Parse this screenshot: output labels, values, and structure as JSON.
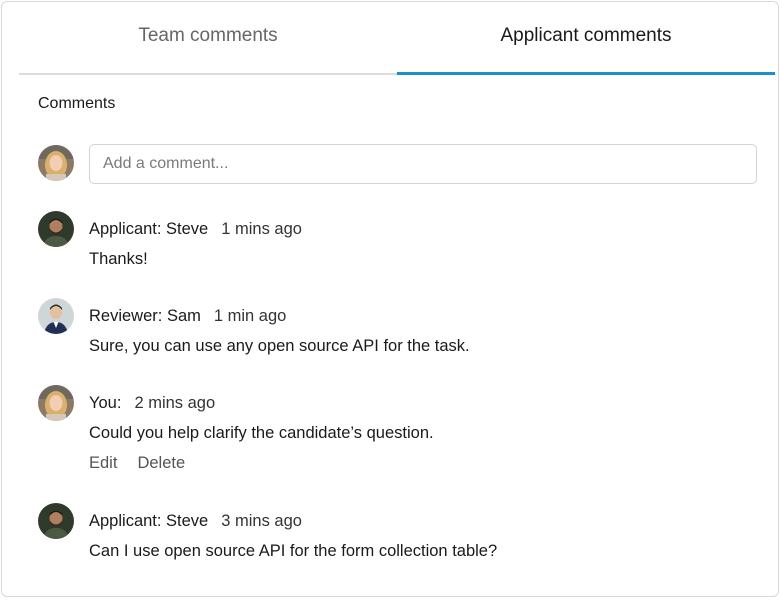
{
  "tabs": [
    {
      "label": "Team comments",
      "active": false
    },
    {
      "label": "Applicant comments",
      "active": true
    }
  ],
  "section_title": "Comments",
  "add_comment": {
    "placeholder": "Add a comment..."
  },
  "comments": [
    {
      "author": "Applicant: Steve",
      "time": "1 mins ago",
      "text": "Thanks!",
      "avatar": "steve"
    },
    {
      "author": "Reviewer: Sam",
      "time": "1 min ago",
      "text": "Sure, you can use any open source API for the task.",
      "avatar": "sam"
    },
    {
      "author": "You:",
      "time": "2 mins ago",
      "text": "Could you help clarify the candidate’s question.",
      "avatar": "you",
      "actions": {
        "edit": "Edit",
        "delete": "Delete"
      }
    },
    {
      "author": "Applicant: Steve",
      "time": "3 mins ago",
      "text": "Can I use open source API for the form collection table?",
      "avatar": "steve"
    }
  ],
  "colors": {
    "accent": "#1b8fcb"
  }
}
